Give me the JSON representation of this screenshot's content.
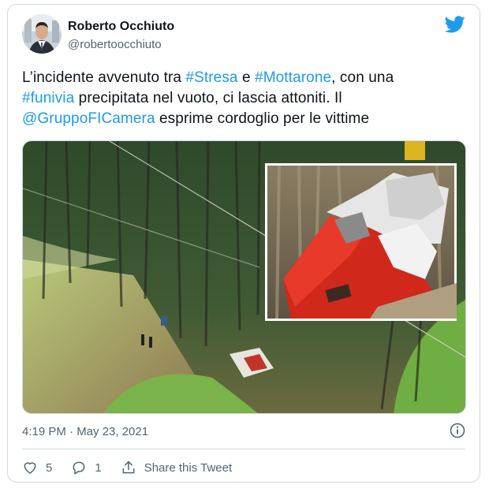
{
  "tweet": {
    "author_name": "Roberto Occhiuto",
    "author_handle": "@robertoocchiuto",
    "text": {
      "t1": "L’incidente avvenuto tra ",
      "stresa": "#Stresa",
      "t2": " e ",
      "mottarone": "#Mottarone",
      "t3": ", con una",
      "funivia": "#funivia",
      "t4": " precipitata nel vuoto, ci lascia attoniti. Il",
      "mention": "@GruppoFICamera",
      "t5": " esprime cordoglio per le vittime"
    },
    "timestamp": "4:19 PM · May 23, 2021",
    "likes": "5",
    "replies": "1",
    "share_label": "Share this Tweet"
  },
  "icons": {
    "brand": "twitter-bird-icon",
    "info": "info-icon",
    "like": "heart-icon",
    "reply": "reply-icon",
    "share": "share-icon"
  },
  "colors": {
    "link": "#1d9bf0",
    "muted": "#536471",
    "border": "#cfd9de"
  }
}
